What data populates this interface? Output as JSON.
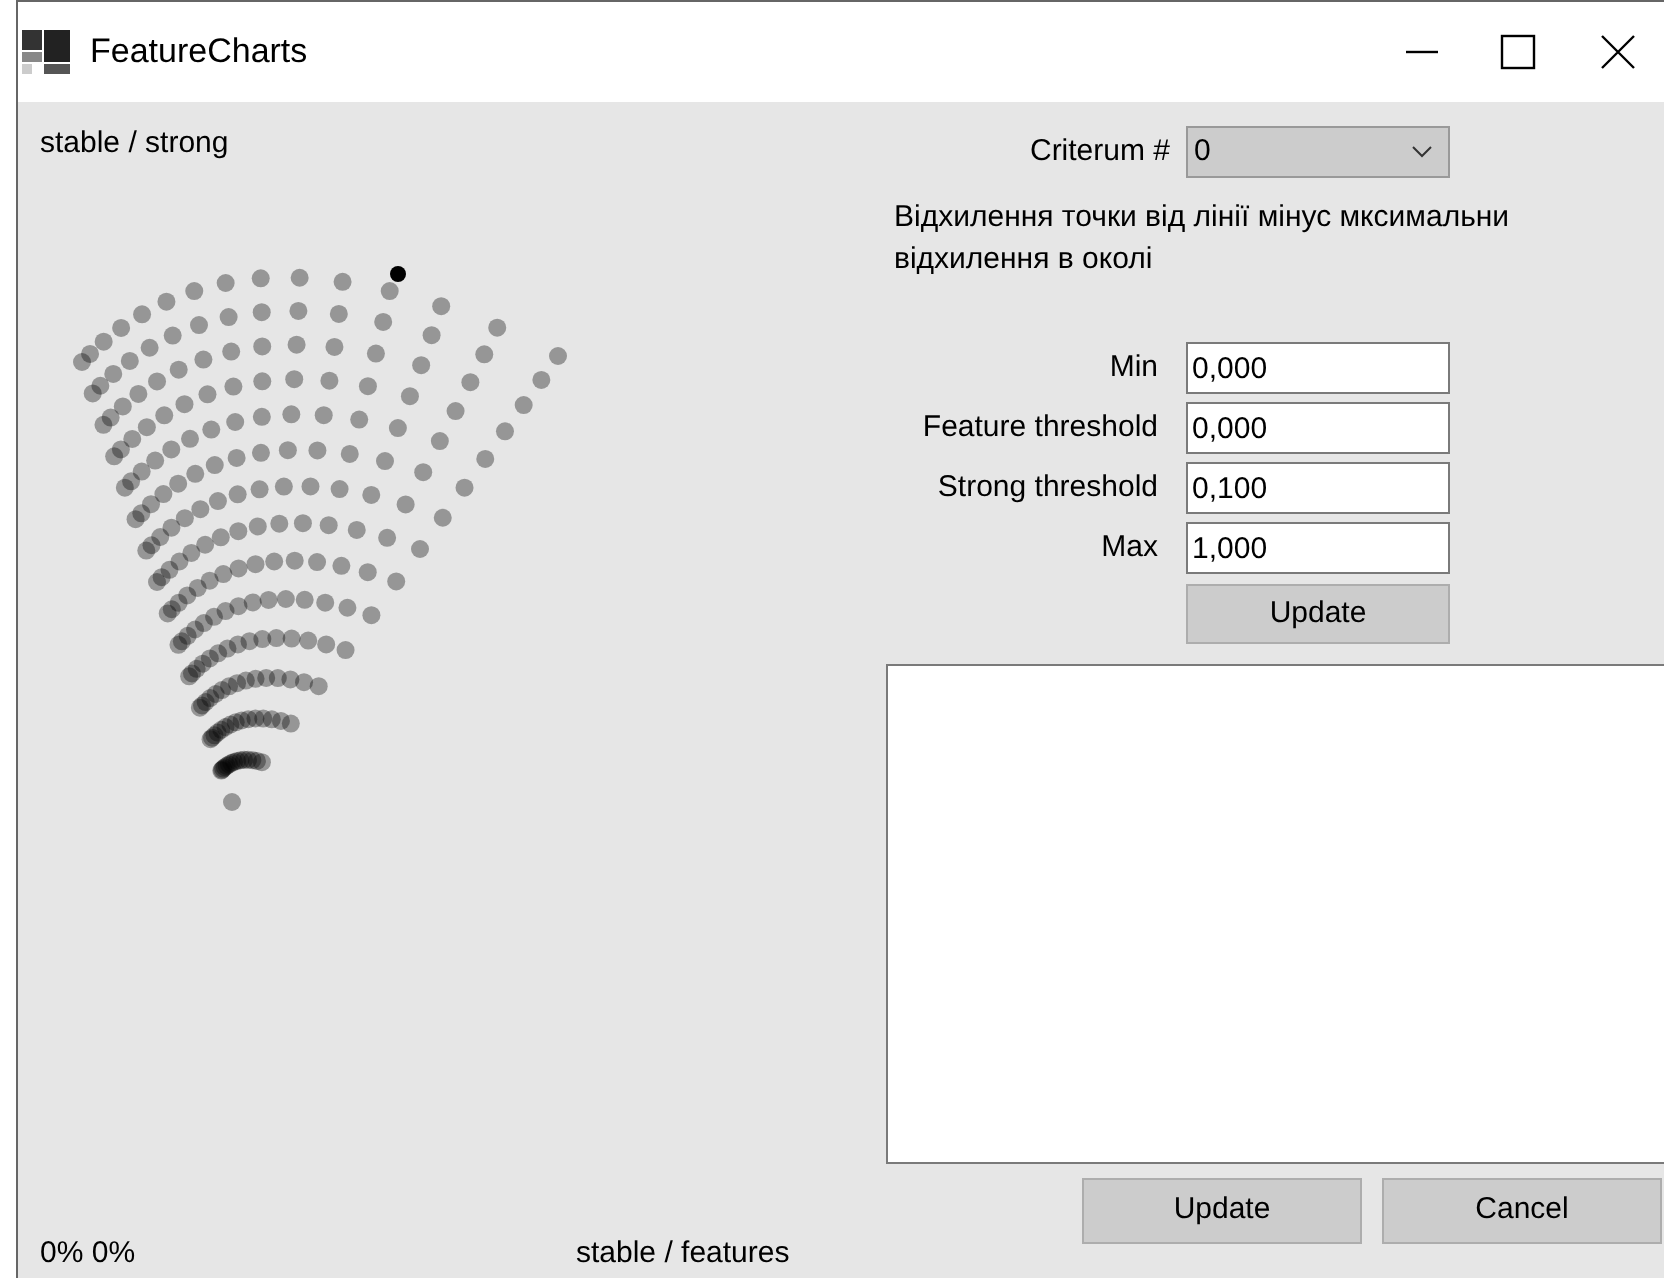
{
  "window": {
    "title": "FeatureCharts"
  },
  "chart": {
    "top_label": "stable / strong",
    "bottom_label": "stable / features",
    "position": "0% 0%"
  },
  "criterion": {
    "label": "Criterum #",
    "value": "0"
  },
  "description": "Відхилення точки від лінії мінус мксимальни відхилення в околі",
  "fields": [
    {
      "label": "Min",
      "value": "0,000"
    },
    {
      "label": "Feature threshold",
      "value": "0,000"
    },
    {
      "label": "Strong threshold",
      "value": "0,100"
    },
    {
      "label": "Max",
      "value": "1,000"
    }
  ],
  "update_button": "Update",
  "buttons": [
    "Update",
    "Cancel"
  ]
}
